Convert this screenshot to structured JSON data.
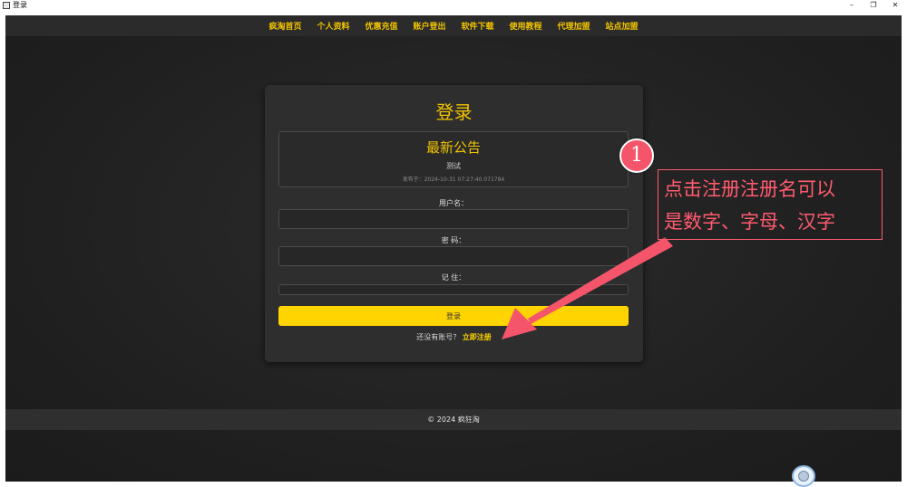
{
  "window": {
    "title": "登录",
    "minimize": "–",
    "maximize": "❐",
    "close": "✕"
  },
  "nav": [
    "疯淘首页",
    "个人资料",
    "优惠充值",
    "账户登出",
    "软件下载",
    "使用教程",
    "代理加盟",
    "站点加盟"
  ],
  "login": {
    "title": "登录",
    "notice": {
      "title": "最新公告",
      "body": "测试",
      "date": "发布于：2024-10-31 07:27:40.071784"
    },
    "username_label": "用户名：",
    "password_label": "密 码：",
    "remember_label": "记 住：",
    "login_button": "登录",
    "register_prompt": "还没有账号？",
    "register_link": "立即注册"
  },
  "footer": {
    "text": "© 2024 疯狂淘"
  },
  "annotation": {
    "number": "1",
    "text_line1": "点击注册注册名可以",
    "text_line2": "是数字、字母、汉字"
  },
  "colors": {
    "accent": "#ffd400",
    "annotation": "#ff5b6e"
  }
}
